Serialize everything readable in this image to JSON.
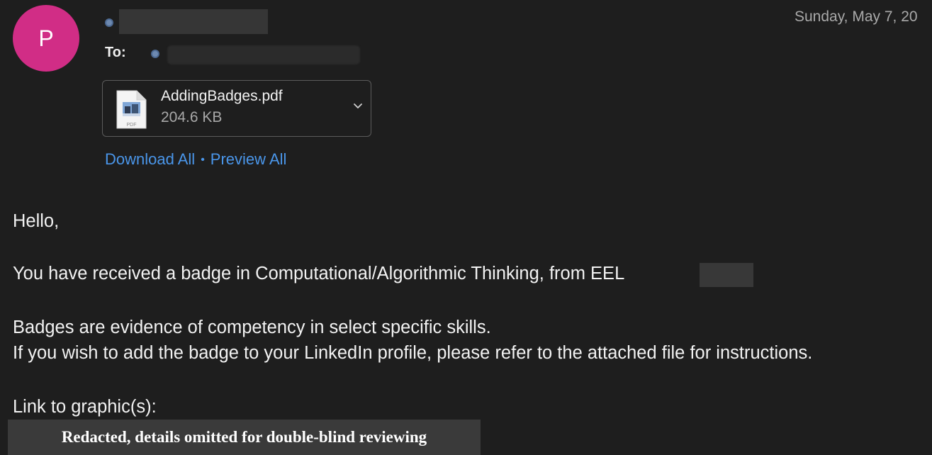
{
  "sender": {
    "avatar_initial": "P",
    "avatar_color": "#d12d86"
  },
  "header": {
    "to_label": "To:",
    "date": "Sunday, May 7, 20"
  },
  "attachment": {
    "file_name": "AddingBadges.pdf",
    "file_size": "204.6 KB",
    "file_type_label": "PDF",
    "icon": "pdf-file-icon"
  },
  "attachment_actions": {
    "download_all": "Download All",
    "separator": "•",
    "preview_all": "Preview All"
  },
  "body": {
    "greeting": "Hello,",
    "line1": "You have received a badge in Computational/Algorithmic Thinking, from EEL",
    "line2": "Badges are evidence of competency in select specific skills.",
    "line3": "If you wish to add the badge to your LinkedIn profile, please refer to the attached file for instructions.",
    "line4": "Link to graphic(s):"
  },
  "redaction_note": "Redacted, details omitted for double-blind reviewing",
  "colors": {
    "background": "#1e1e1e",
    "link": "#4a96ea",
    "status_dot": "#6d89b0"
  }
}
